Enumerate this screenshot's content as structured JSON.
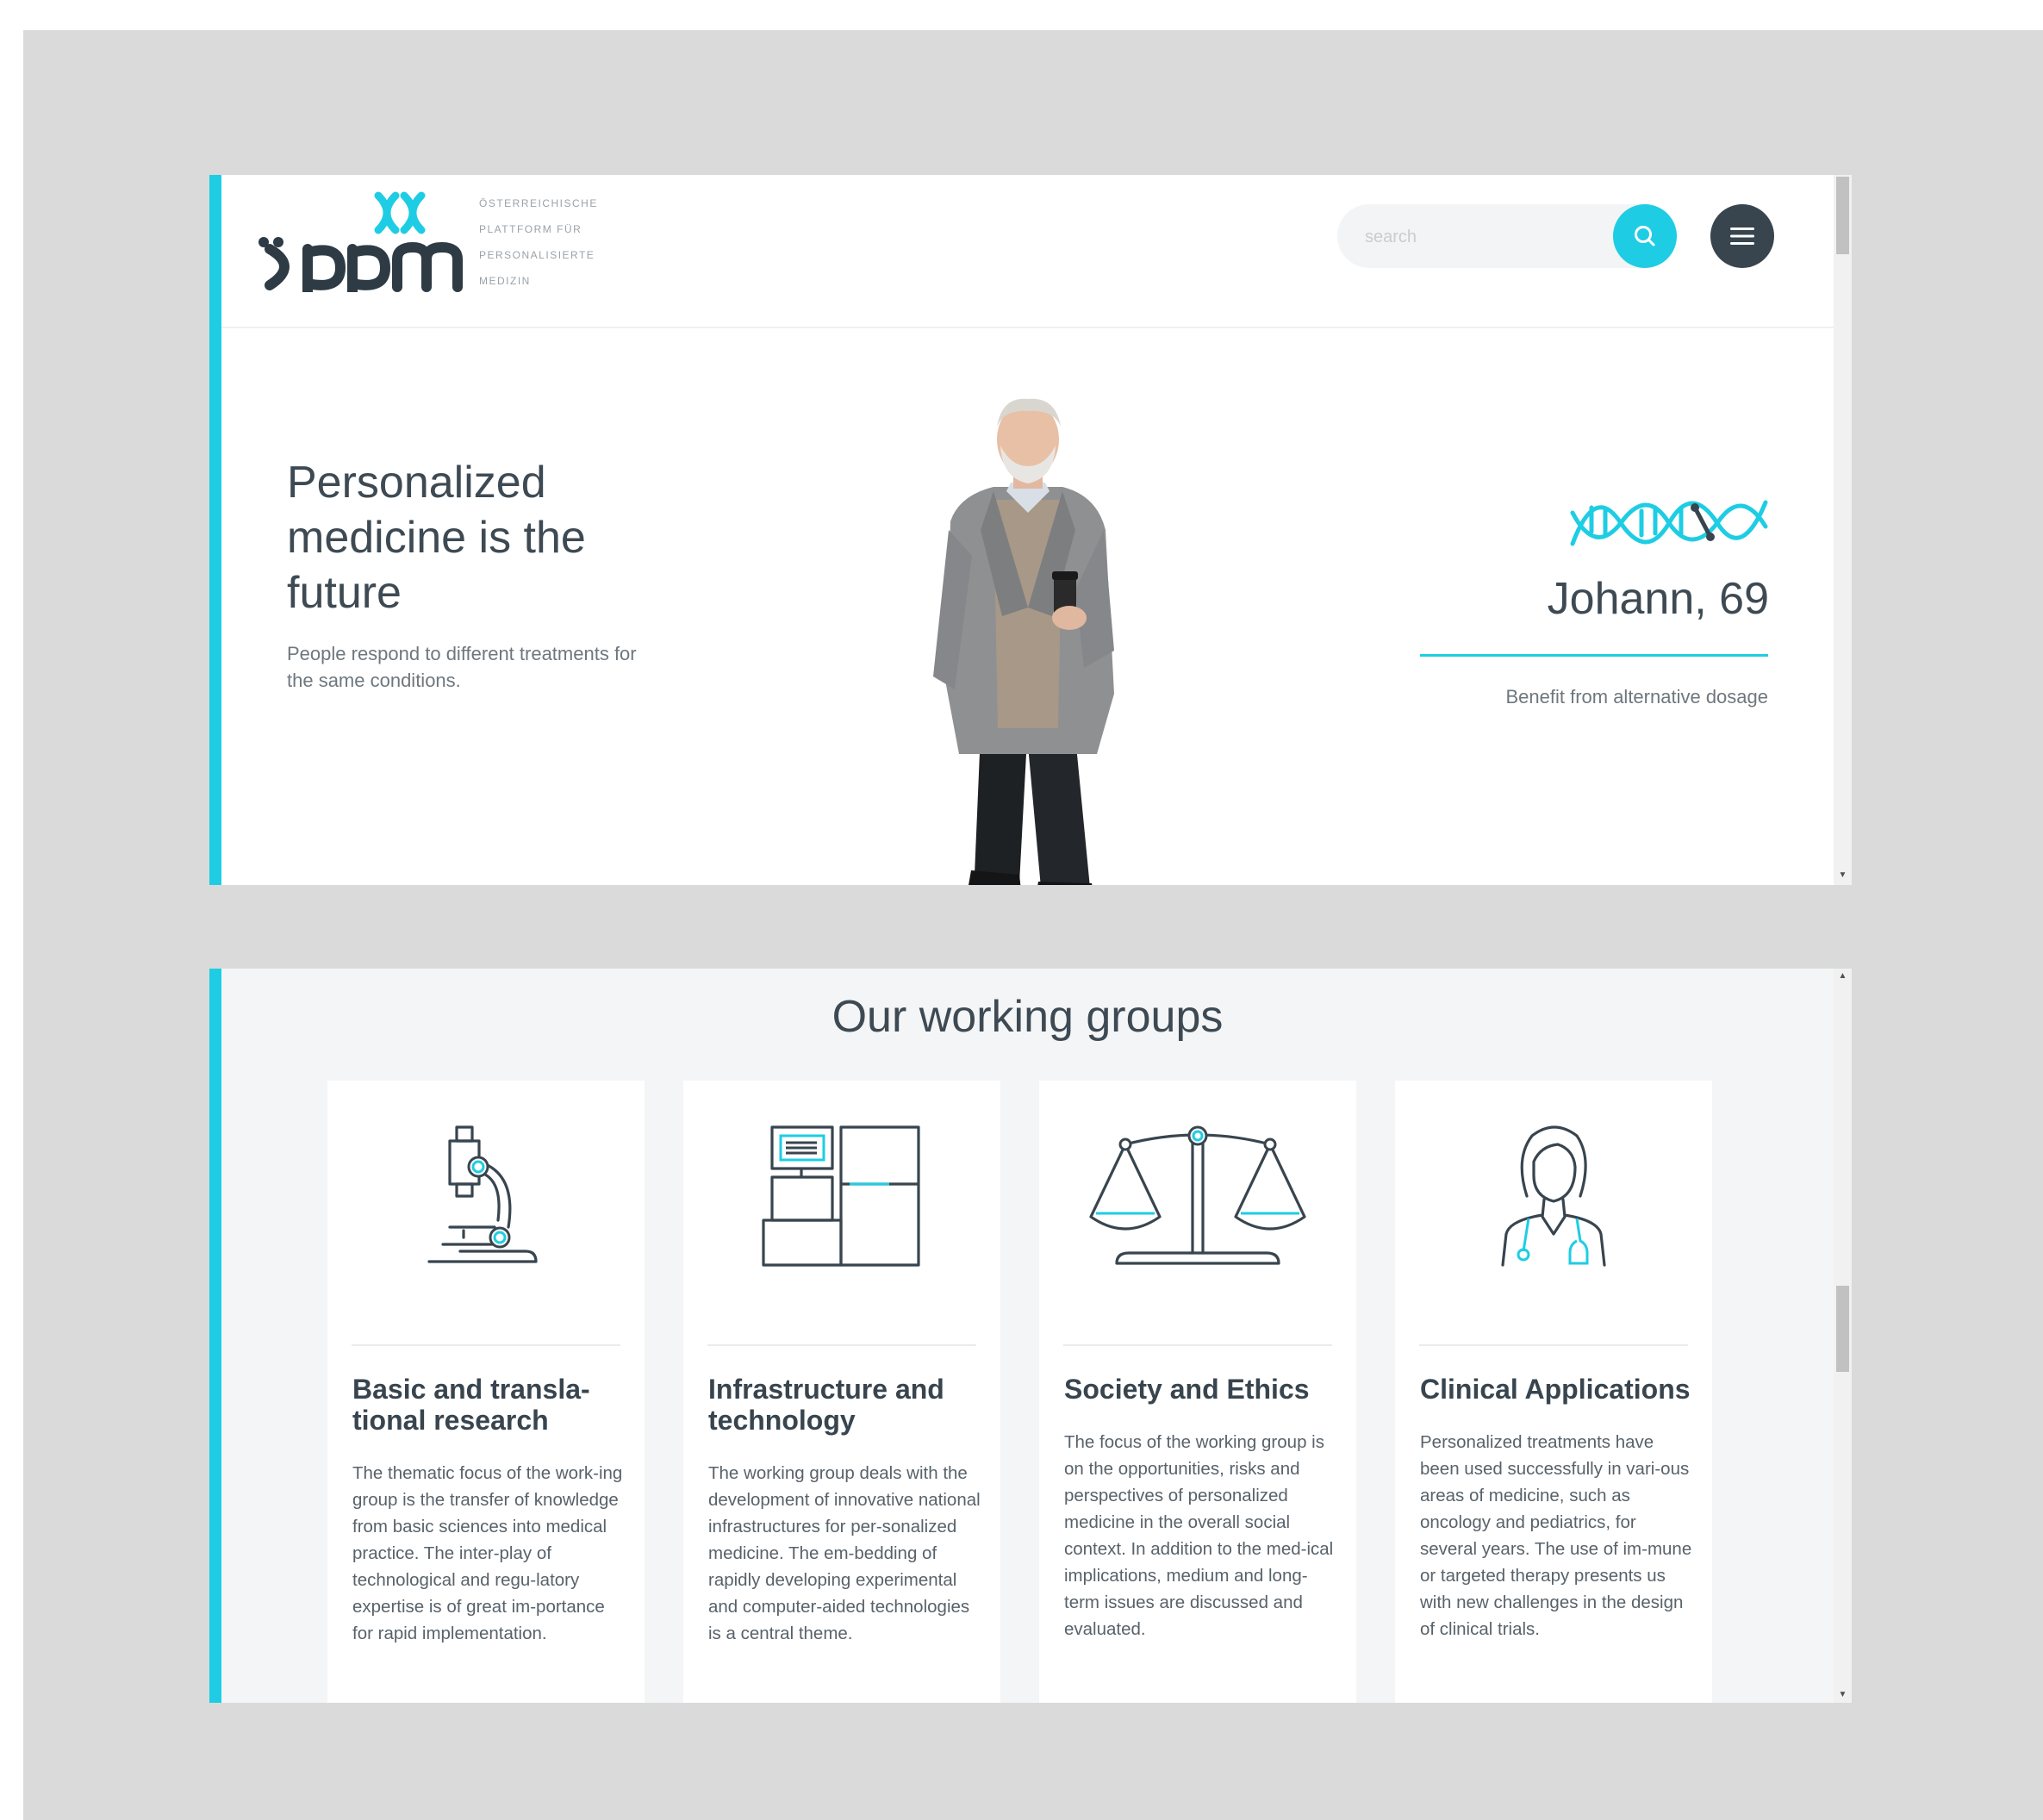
{
  "brand": {
    "logo_text": "öppm",
    "tagline": [
      "ÖSTERREICHISCHE",
      "PLATTFORM FÜR",
      "PERSONALISIERTE",
      "MEDIZIN"
    ]
  },
  "search": {
    "placeholder": "search"
  },
  "colors": {
    "accent": "#1ecde3",
    "dark": "#38454f",
    "text": "#3e4a53",
    "muted": "#6e777e"
  },
  "icons": {
    "search": "search-icon",
    "menu": "hamburger-menu-icon",
    "dna": "dna-icon"
  },
  "hero": {
    "title": "Personalized medicine is the future",
    "subtitle": "People respond to different treatments for the same conditions.",
    "person_name": "Johann, 69",
    "benefit": "Benefit from alternative dosage"
  },
  "working_groups": {
    "title": "Our working groups",
    "cards": [
      {
        "icon": "microscope-icon",
        "title": "Basic and transla-tional research",
        "text": "The thematic focus of the work-ing group is the transfer of knowledge from basic sciences into medical practice. The inter-play of technological and regu-latory expertise is of great im-portance for rapid implementation."
      },
      {
        "icon": "lab-equipment-icon",
        "title": "Infrastructure and technology",
        "text": "The working group deals with the development of innovative national infrastructures for per-sonalized medicine. The em-bedding of rapidly developing experimental and computer-aided technologies is a central theme."
      },
      {
        "icon": "scales-icon",
        "title": "Society and Ethics",
        "text": "The focus of the working group is on the opportunities, risks and perspectives of personalized medicine in the overall social context. In addition to the med-ical implications, medium and long-term issues are discussed and evaluated."
      },
      {
        "icon": "doctor-icon",
        "title": "Clinical Applications",
        "text": "Personalized treatments have been used successfully in vari-ous areas of medicine, such as oncology and pediatrics, for several years. The use of im-mune or targeted therapy presents us with new challenges in the design of clinical trials."
      }
    ]
  }
}
